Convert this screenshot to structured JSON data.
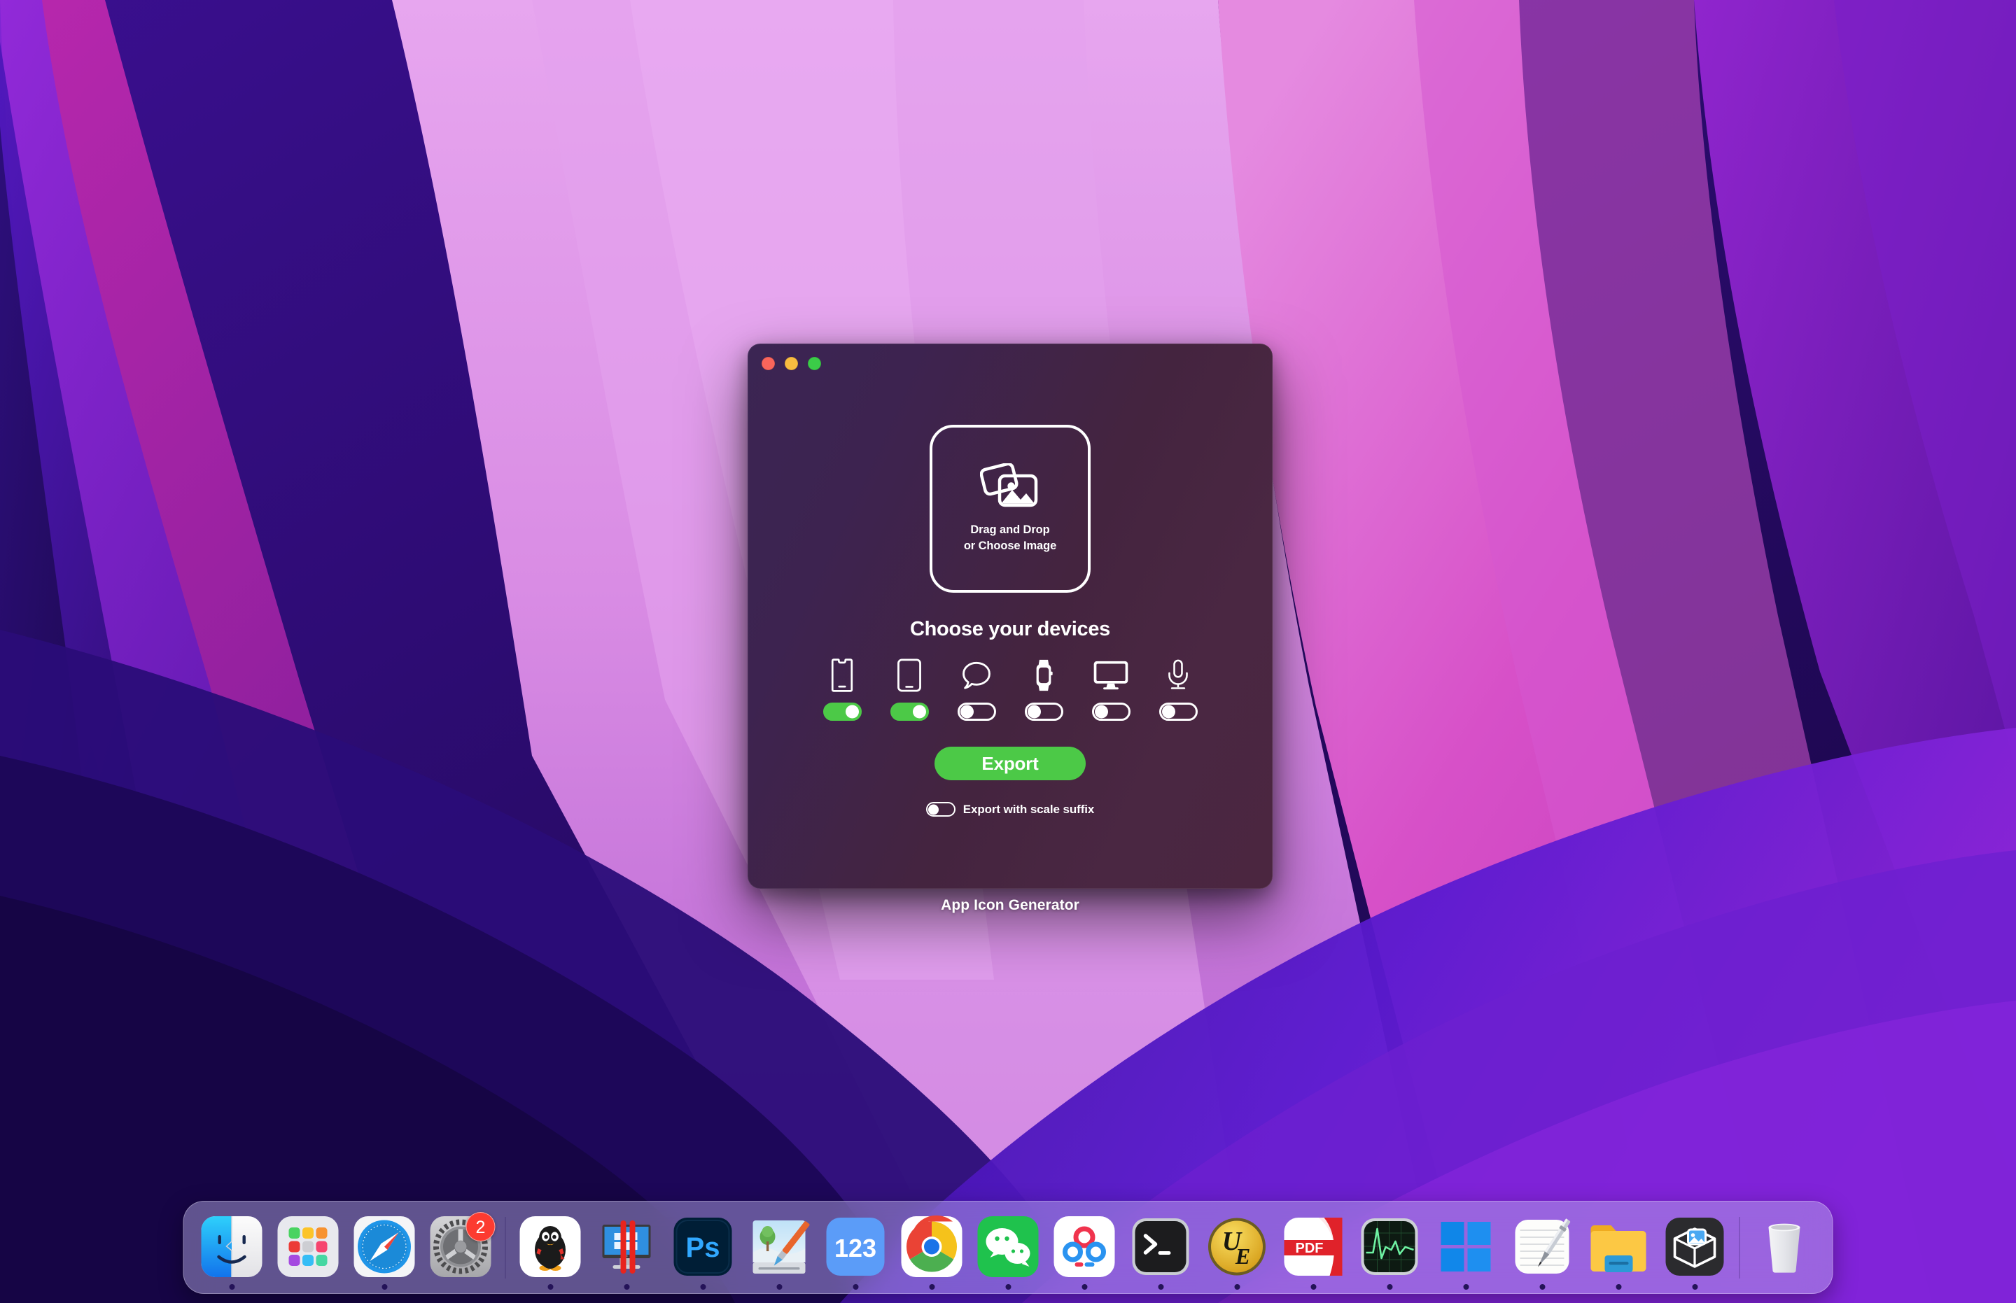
{
  "window": {
    "traffic_lights": [
      {
        "name": "close",
        "color": "#f9655b"
      },
      {
        "name": "minimize",
        "color": "#f9bc40"
      },
      {
        "name": "zoom",
        "color": "#3bcc48"
      }
    ],
    "drop_zone": {
      "icon": "photos-stack-icon",
      "line1": "Drag and Drop",
      "line2": "or Choose Image"
    },
    "devices_title": "Choose your devices",
    "devices": [
      {
        "name": "iphone",
        "icon": "iphone-icon",
        "enabled": true
      },
      {
        "name": "ipad",
        "icon": "ipad-icon",
        "enabled": true
      },
      {
        "name": "imessage",
        "icon": "message-bubble-icon",
        "enabled": false
      },
      {
        "name": "watch",
        "icon": "apple-watch-icon",
        "enabled": false
      },
      {
        "name": "mac",
        "icon": "imac-display-icon",
        "enabled": false
      },
      {
        "name": "carplay",
        "icon": "microphone-icon",
        "enabled": false
      }
    ],
    "export_label": "Export",
    "scale_suffix_label": "Export with scale suffix",
    "scale_suffix_enabled": false,
    "accent_green": "#4cc947"
  },
  "caption": "App Icon Generator",
  "dock": {
    "items": [
      {
        "name": "finder",
        "label": "Finder",
        "running": true,
        "badge": null
      },
      {
        "name": "launchpad",
        "label": "Launchpad",
        "running": false,
        "badge": null
      },
      {
        "name": "safari",
        "label": "Safari",
        "running": true,
        "badge": null
      },
      {
        "name": "system-preferences",
        "label": "System Preferences",
        "running": false,
        "badge": "2"
      },
      {
        "separator": true
      },
      {
        "name": "qq",
        "label": "QQ",
        "running": true,
        "badge": null
      },
      {
        "name": "parallels-desktop",
        "label": "Parallels Desktop",
        "running": true,
        "badge": null
      },
      {
        "name": "photoshop",
        "label": "Adobe Photoshop",
        "running": true,
        "badge": null
      },
      {
        "name": "paintbrush",
        "label": "Paintbrush",
        "running": true,
        "badge": null
      },
      {
        "name": "123-pan",
        "label": "123",
        "running": true,
        "badge": null
      },
      {
        "name": "google-chrome",
        "label": "Google Chrome",
        "running": true,
        "badge": null
      },
      {
        "name": "wechat",
        "label": "WeChat",
        "running": true,
        "badge": null
      },
      {
        "name": "baidu-netdisk",
        "label": "Baidu Netdisk",
        "running": true,
        "badge": null
      },
      {
        "name": "terminal",
        "label": "Terminal",
        "running": true,
        "badge": null
      },
      {
        "name": "ultraedit",
        "label": "UltraEdit",
        "running": true,
        "badge": null
      },
      {
        "name": "pdf-expert",
        "label": "PDF Expert",
        "running": true,
        "badge": null
      },
      {
        "name": "activity-monitor",
        "label": "Activity Monitor",
        "running": true,
        "badge": null
      },
      {
        "name": "windows-app",
        "label": "Windows",
        "running": true,
        "badge": null
      },
      {
        "name": "notes",
        "label": "Notes",
        "running": true,
        "badge": null
      },
      {
        "name": "file-manager",
        "label": "File Manager",
        "running": true,
        "badge": null
      },
      {
        "name": "app-icon-generator",
        "label": "App Icon Generator",
        "running": true,
        "badge": null
      },
      {
        "separator": true
      },
      {
        "name": "trash",
        "label": "Trash",
        "running": false,
        "badge": null
      }
    ]
  }
}
